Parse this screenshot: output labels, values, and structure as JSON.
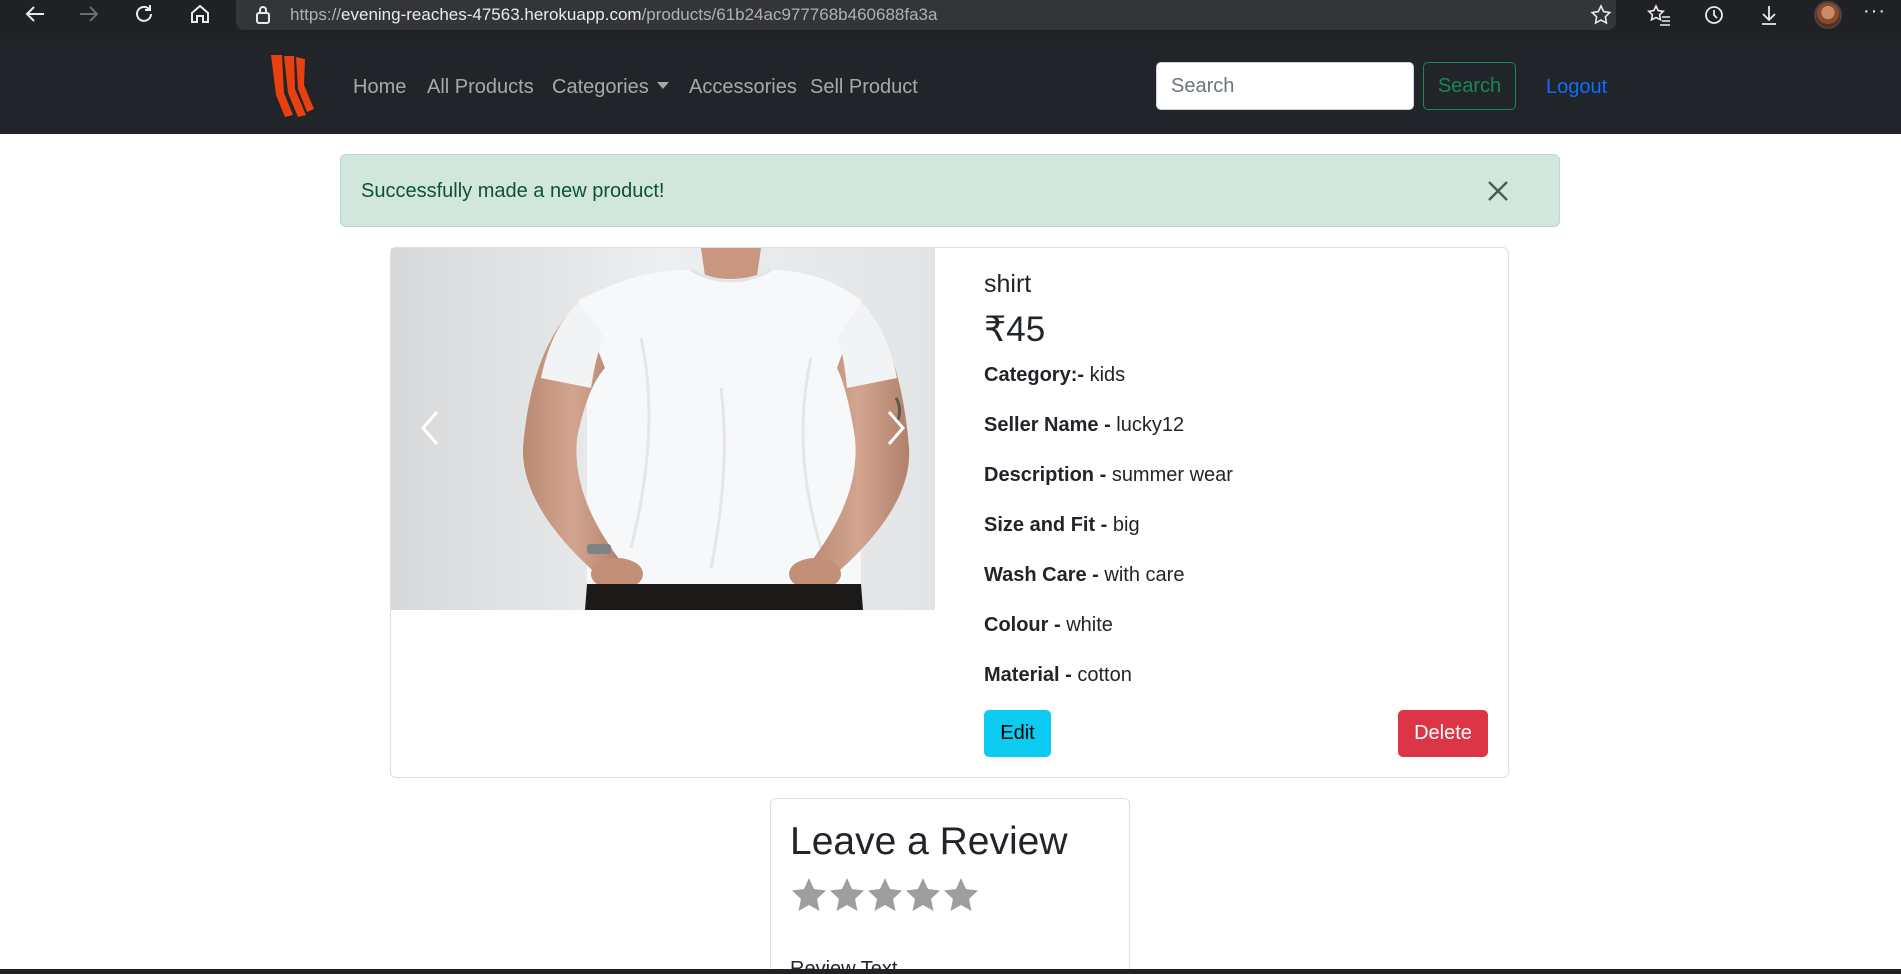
{
  "browser": {
    "url_prefix": "https://",
    "url_host": "evening-reaches-47563.herokuapp.com",
    "url_path": "/products/61b24ac977768b460688fa3a",
    "more_label": "···"
  },
  "navbar": {
    "links": [
      {
        "label": "Home"
      },
      {
        "label": "All Products"
      },
      {
        "label": "Categories"
      },
      {
        "label": "Accessories"
      },
      {
        "label": "Sell Product"
      }
    ],
    "search_placeholder": "Search",
    "search_button": "Search",
    "logout": "Logout",
    "logo_color": "#e8400e"
  },
  "alert": {
    "message": "Successfully made a new product!"
  },
  "product": {
    "title": "shirt",
    "price": "₹45",
    "attributes": [
      {
        "label": "Category:-",
        "value": "kids"
      },
      {
        "label": "Seller Name -",
        "value": "lucky12"
      },
      {
        "label": "Description -",
        "value": "summer wear"
      },
      {
        "label": "Size and Fit -",
        "value": "big"
      },
      {
        "label": "Wash Care -",
        "value": "with care"
      },
      {
        "label": "Colour -",
        "value": "white"
      },
      {
        "label": "Material -",
        "value": "cotton"
      }
    ],
    "edit_button": "Edit",
    "delete_button": "Delete"
  },
  "review": {
    "heading": "Leave a Review",
    "rating": 0,
    "rating_max": 5,
    "text_label": "Review Text"
  },
  "colors": {
    "primary": "#0d6efd",
    "success": "#198754",
    "info": "#0dcaf0",
    "danger": "#dc3545",
    "dark": "#212529",
    "alert_bg": "#d1e7dd"
  }
}
